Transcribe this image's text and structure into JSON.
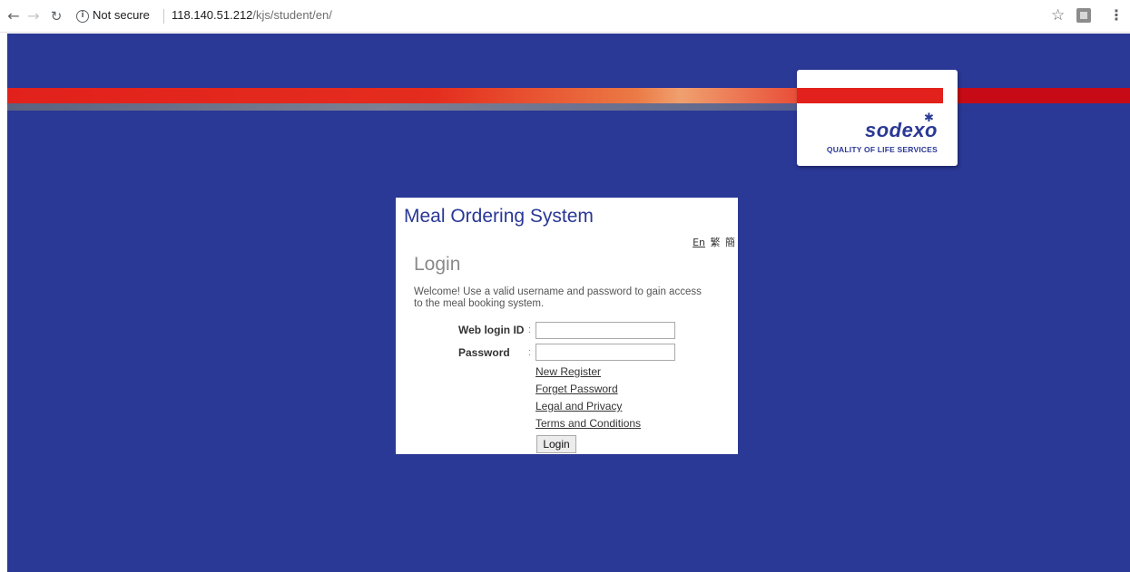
{
  "browser": {
    "security_label": "Not secure",
    "url_host": "118.140.51.212",
    "url_path": "/kjs/student/en/"
  },
  "logo": {
    "word": "sodexo",
    "tagline": "QUALITY OF LIFE SERVICES"
  },
  "panel": {
    "app_title": "Meal Ordering System",
    "languages": [
      "En",
      "繁",
      "簡"
    ],
    "heading": "Login",
    "welcome": "Welcome! Use a valid username and password to gain access to the meal booking system.",
    "login_id_label": "Web login ID",
    "password_label": "Password",
    "login_id_value": "",
    "password_value": "",
    "links": {
      "new_register": "New Register",
      "forget_password": "Forget Password",
      "legal_privacy": "Legal and Privacy",
      "terms": "Terms and Conditions"
    },
    "login_button": "Login"
  },
  "colors": {
    "page_background": "#2a3896",
    "brand_red": "#e2211c",
    "brand_blue": "#2a3896"
  }
}
